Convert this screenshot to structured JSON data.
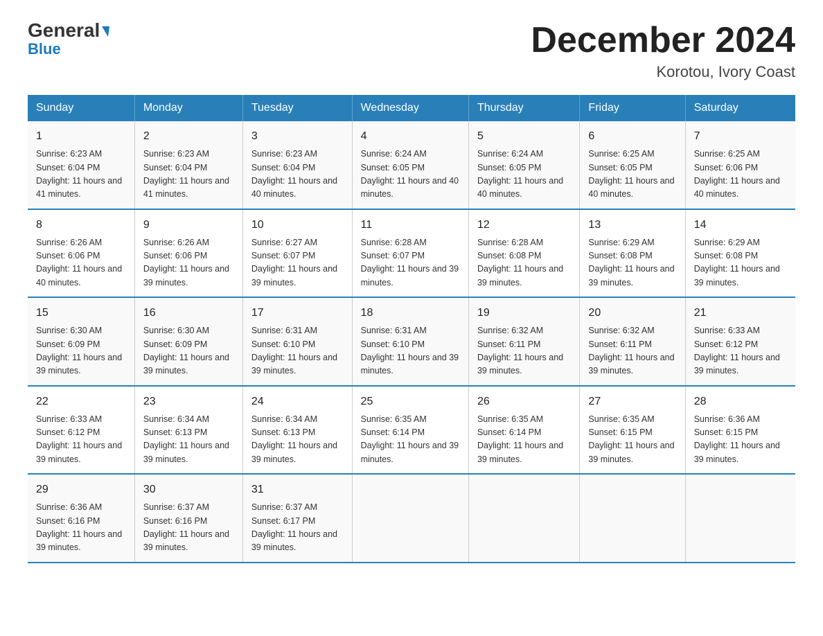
{
  "header": {
    "logo_general": "General",
    "logo_blue": "Blue",
    "main_title": "December 2024",
    "subtitle": "Korotou, Ivory Coast"
  },
  "days_of_week": [
    "Sunday",
    "Monday",
    "Tuesday",
    "Wednesday",
    "Thursday",
    "Friday",
    "Saturday"
  ],
  "weeks": [
    [
      {
        "day": "1",
        "sunrise": "6:23 AM",
        "sunset": "6:04 PM",
        "daylight": "11 hours and 41 minutes."
      },
      {
        "day": "2",
        "sunrise": "6:23 AM",
        "sunset": "6:04 PM",
        "daylight": "11 hours and 41 minutes."
      },
      {
        "day": "3",
        "sunrise": "6:23 AM",
        "sunset": "6:04 PM",
        "daylight": "11 hours and 40 minutes."
      },
      {
        "day": "4",
        "sunrise": "6:24 AM",
        "sunset": "6:05 PM",
        "daylight": "11 hours and 40 minutes."
      },
      {
        "day": "5",
        "sunrise": "6:24 AM",
        "sunset": "6:05 PM",
        "daylight": "11 hours and 40 minutes."
      },
      {
        "day": "6",
        "sunrise": "6:25 AM",
        "sunset": "6:05 PM",
        "daylight": "11 hours and 40 minutes."
      },
      {
        "day": "7",
        "sunrise": "6:25 AM",
        "sunset": "6:06 PM",
        "daylight": "11 hours and 40 minutes."
      }
    ],
    [
      {
        "day": "8",
        "sunrise": "6:26 AM",
        "sunset": "6:06 PM",
        "daylight": "11 hours and 40 minutes."
      },
      {
        "day": "9",
        "sunrise": "6:26 AM",
        "sunset": "6:06 PM",
        "daylight": "11 hours and 39 minutes."
      },
      {
        "day": "10",
        "sunrise": "6:27 AM",
        "sunset": "6:07 PM",
        "daylight": "11 hours and 39 minutes."
      },
      {
        "day": "11",
        "sunrise": "6:28 AM",
        "sunset": "6:07 PM",
        "daylight": "11 hours and 39 minutes."
      },
      {
        "day": "12",
        "sunrise": "6:28 AM",
        "sunset": "6:08 PM",
        "daylight": "11 hours and 39 minutes."
      },
      {
        "day": "13",
        "sunrise": "6:29 AM",
        "sunset": "6:08 PM",
        "daylight": "11 hours and 39 minutes."
      },
      {
        "day": "14",
        "sunrise": "6:29 AM",
        "sunset": "6:08 PM",
        "daylight": "11 hours and 39 minutes."
      }
    ],
    [
      {
        "day": "15",
        "sunrise": "6:30 AM",
        "sunset": "6:09 PM",
        "daylight": "11 hours and 39 minutes."
      },
      {
        "day": "16",
        "sunrise": "6:30 AM",
        "sunset": "6:09 PM",
        "daylight": "11 hours and 39 minutes."
      },
      {
        "day": "17",
        "sunrise": "6:31 AM",
        "sunset": "6:10 PM",
        "daylight": "11 hours and 39 minutes."
      },
      {
        "day": "18",
        "sunrise": "6:31 AM",
        "sunset": "6:10 PM",
        "daylight": "11 hours and 39 minutes."
      },
      {
        "day": "19",
        "sunrise": "6:32 AM",
        "sunset": "6:11 PM",
        "daylight": "11 hours and 39 minutes."
      },
      {
        "day": "20",
        "sunrise": "6:32 AM",
        "sunset": "6:11 PM",
        "daylight": "11 hours and 39 minutes."
      },
      {
        "day": "21",
        "sunrise": "6:33 AM",
        "sunset": "6:12 PM",
        "daylight": "11 hours and 39 minutes."
      }
    ],
    [
      {
        "day": "22",
        "sunrise": "6:33 AM",
        "sunset": "6:12 PM",
        "daylight": "11 hours and 39 minutes."
      },
      {
        "day": "23",
        "sunrise": "6:34 AM",
        "sunset": "6:13 PM",
        "daylight": "11 hours and 39 minutes."
      },
      {
        "day": "24",
        "sunrise": "6:34 AM",
        "sunset": "6:13 PM",
        "daylight": "11 hours and 39 minutes."
      },
      {
        "day": "25",
        "sunrise": "6:35 AM",
        "sunset": "6:14 PM",
        "daylight": "11 hours and 39 minutes."
      },
      {
        "day": "26",
        "sunrise": "6:35 AM",
        "sunset": "6:14 PM",
        "daylight": "11 hours and 39 minutes."
      },
      {
        "day": "27",
        "sunrise": "6:35 AM",
        "sunset": "6:15 PM",
        "daylight": "11 hours and 39 minutes."
      },
      {
        "day": "28",
        "sunrise": "6:36 AM",
        "sunset": "6:15 PM",
        "daylight": "11 hours and 39 minutes."
      }
    ],
    [
      {
        "day": "29",
        "sunrise": "6:36 AM",
        "sunset": "6:16 PM",
        "daylight": "11 hours and 39 minutes."
      },
      {
        "day": "30",
        "sunrise": "6:37 AM",
        "sunset": "6:16 PM",
        "daylight": "11 hours and 39 minutes."
      },
      {
        "day": "31",
        "sunrise": "6:37 AM",
        "sunset": "6:17 PM",
        "daylight": "11 hours and 39 minutes."
      },
      {
        "day": "",
        "sunrise": "",
        "sunset": "",
        "daylight": ""
      },
      {
        "day": "",
        "sunrise": "",
        "sunset": "",
        "daylight": ""
      },
      {
        "day": "",
        "sunrise": "",
        "sunset": "",
        "daylight": ""
      },
      {
        "day": "",
        "sunrise": "",
        "sunset": "",
        "daylight": ""
      }
    ]
  ]
}
